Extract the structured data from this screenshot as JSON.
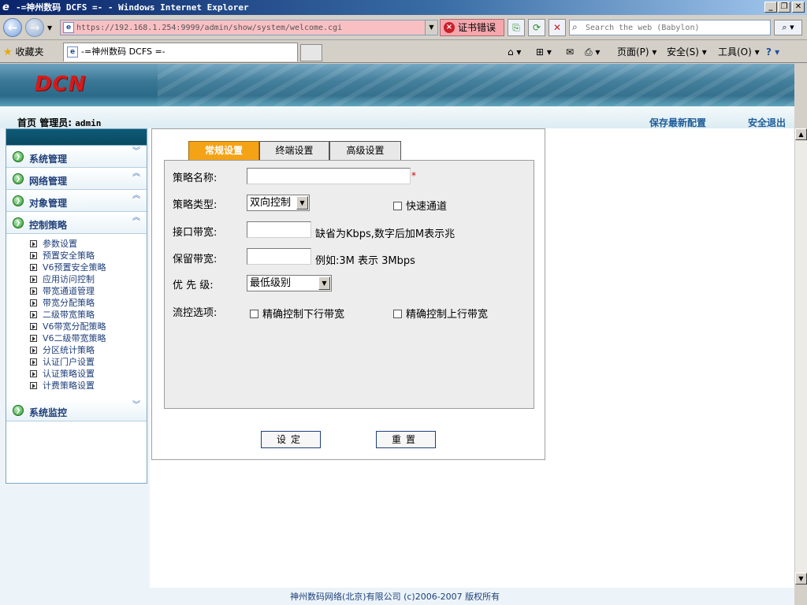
{
  "window": {
    "title": "-=神州数码 DCFS =- - Windows Internet Explorer",
    "minimize": "_",
    "restore": "❐",
    "close": "✕"
  },
  "navbar": {
    "url": "https://192.168.1.254:9999/admin/show/system/welcome.cgi",
    "cert_error": "证书错误",
    "search_placeholder": "Search the web (Babylon)"
  },
  "favbar": {
    "favorites": "收藏夹",
    "tab_title": "-=神州数码 DCFS =-",
    "page_menu": "页面(P)",
    "safety_menu": "安全(S)",
    "tools_menu": "工具(O)"
  },
  "header": {
    "logo": "DCN",
    "home": "首页",
    "admin_label": "管理员:",
    "admin_name": "admin",
    "save_config": "保存最新配置",
    "logout": "安全退出"
  },
  "sidebar": {
    "menus": [
      "系统管理",
      "网络管理",
      "对象管理",
      "控制策略",
      "系统监控"
    ],
    "control_items": [
      "参数设置",
      "预置安全策略",
      "V6预置安全策略",
      "应用访问控制",
      "带宽通道管理",
      "带宽分配策略",
      "二级带宽策略",
      "V6带宽分配策略",
      "V6二级带宽策略",
      "分区统计策略",
      "认证门户设置",
      "认证策略设置",
      "计费策略设置"
    ]
  },
  "form": {
    "tabs": [
      "常规设置",
      "终端设置",
      "高级设置"
    ],
    "active_tab": 0,
    "policy_name_label": "策略名称:",
    "policy_name_value": "",
    "required_mark": "*",
    "policy_type_label": "策略类型:",
    "policy_type_value": "双向控制",
    "fast_channel_label": "快速通道",
    "iface_bw_label": "接口带宽:",
    "iface_bw_hint": "缺省为Kbps,数字后加M表示兆",
    "reserved_bw_label": "保留带宽:",
    "reserved_bw_hint": "例如:3M 表示 3Mbps",
    "priority_label": "优 先 级:",
    "priority_value": "最低级别",
    "flow_label": "流控选项:",
    "precise_down": "精确控制下行带宽",
    "precise_up": "精确控制上行带宽",
    "submit": "设定",
    "reset": "重置"
  },
  "footer": {
    "copyright": "神州数码网络(北京)有限公司 (c)2006-2007 版权所有"
  },
  "colors": {
    "active_tab": "#f4a317",
    "banner": "#2b6a88",
    "link": "#1f5e99",
    "cert_error_bg": "#f4a7ad"
  }
}
